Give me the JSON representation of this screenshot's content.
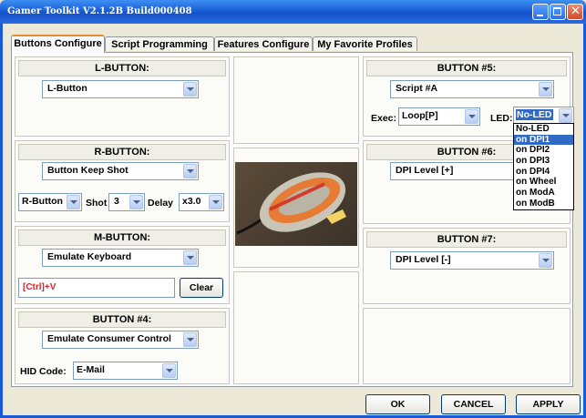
{
  "window": {
    "title": "Gamer Toolkit V2.1.2B Build000408"
  },
  "tabs": [
    "Buttons Configure",
    "Script Programming",
    "Features Configure",
    "My Favorite Profiles"
  ],
  "l_button": {
    "header": "L-BUTTON:",
    "function": "L-Button"
  },
  "r_button": {
    "header": "R-BUTTON:",
    "function": "Button Keep Shot",
    "button": "R-Button",
    "shot_label": "Shot",
    "shot": "3",
    "delay_label": "Delay",
    "delay": "x3.0"
  },
  "m_button": {
    "header": "M-BUTTON:",
    "function": "Emulate Keyboard",
    "keys": "[Ctrl]+V",
    "clear": "Clear"
  },
  "button4": {
    "header": "BUTTON #4:",
    "function": "Emulate Consumer Control",
    "hid_label": "HID Code:",
    "hid": "E-Mail"
  },
  "button5": {
    "header": "BUTTON #5:",
    "function": "Script #A",
    "exec_label": "Exec:",
    "exec": "Loop[P]",
    "led_label": "LED:",
    "led": "No-LED"
  },
  "button6": {
    "header": "BUTTON #6:",
    "function": "DPI Level [+]"
  },
  "button7": {
    "header": "BUTTON #7:",
    "function": "DPI Level [-]"
  },
  "led_options": [
    "No-LED",
    "on DPI1",
    "on DPI2",
    "on DPI3",
    "on DPI4",
    "on Wheel",
    "on ModA",
    "on ModB"
  ],
  "footer": {
    "ok": "OK",
    "cancel": "CANCEL",
    "apply": "APPLY"
  }
}
